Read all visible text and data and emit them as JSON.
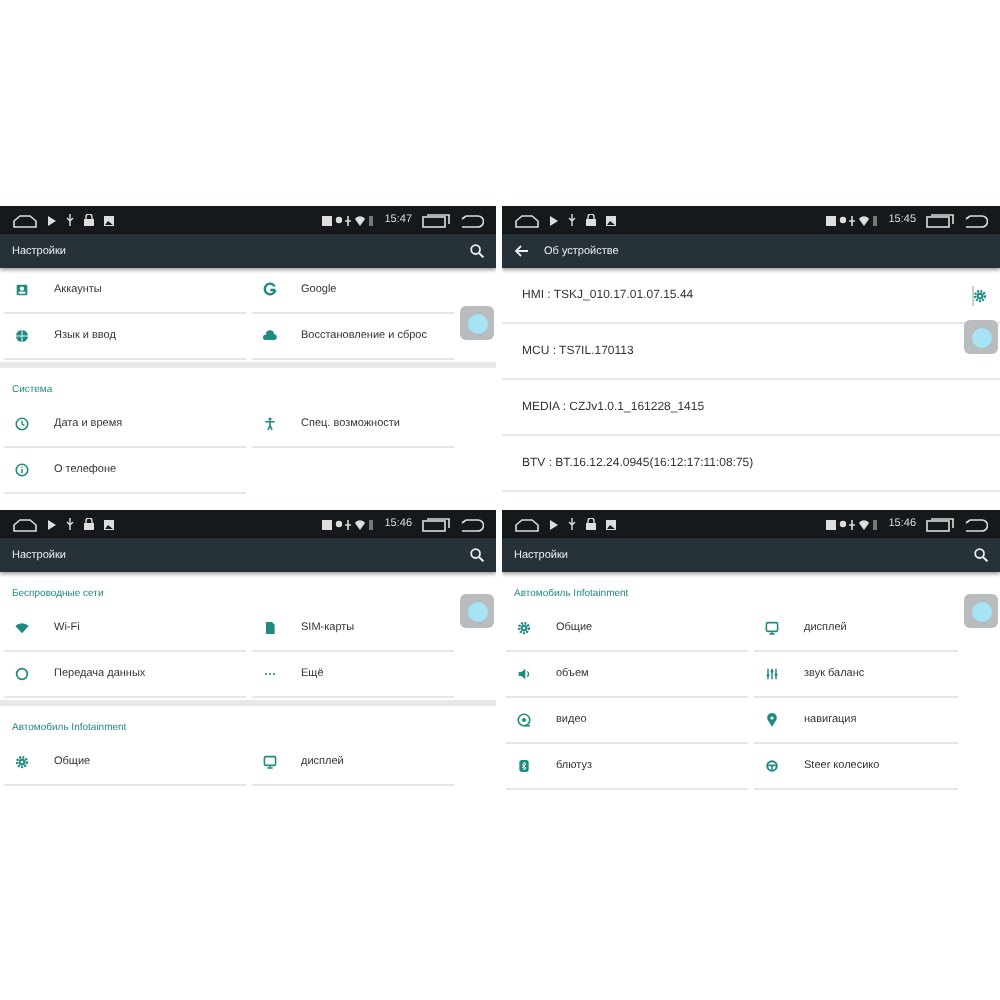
{
  "panels": [
    {
      "kind": "grid",
      "status": {
        "time": "15:47"
      },
      "toolbar": {
        "title": "Настройки",
        "back": false,
        "search": true
      },
      "sections": [
        {
          "items": [
            "Аккаунты",
            "Google",
            "Язык и ввод",
            "Восстановление и сброс"
          ]
        },
        {
          "header": "Система",
          "items": [
            "Дата и время",
            "Спец. возможности",
            "О телефоне"
          ]
        }
      ]
    },
    {
      "kind": "list",
      "status": {
        "time": "15:45"
      },
      "toolbar": {
        "title": "Об устройстве",
        "back": true,
        "search": false
      },
      "items": [
        "HMI : TSKJ_010.17.01.07.15.44",
        "MCU : TS7IL.170113",
        "MEDIA : CZJv1.0.1_161228_1415",
        "BTV : BT.16.12.24.0945(16:12:17:11:08:75)"
      ]
    },
    {
      "kind": "grid",
      "status": {
        "time": "15:46"
      },
      "toolbar": {
        "title": "Настройки",
        "back": false,
        "search": true
      },
      "sections": [
        {
          "header": "Беспроводные сети",
          "items": [
            "Wi-Fi",
            "SIM-карты",
            "Передача данных",
            "Ещё"
          ]
        },
        {
          "header": "Автомобиль Infotainment",
          "items": [
            "Общие",
            "дисплей"
          ]
        }
      ]
    },
    {
      "kind": "grid",
      "status": {
        "time": "15:46"
      },
      "toolbar": {
        "title": "Настройки",
        "back": false,
        "search": true
      },
      "sections": [
        {
          "header": "Автомобиль Infotainment",
          "items": [
            "Общие",
            "дисплей",
            "объем",
            "звук баланс",
            "видео",
            "навигация",
            "блютуз",
            "Steer колесико"
          ]
        }
      ]
    }
  ]
}
